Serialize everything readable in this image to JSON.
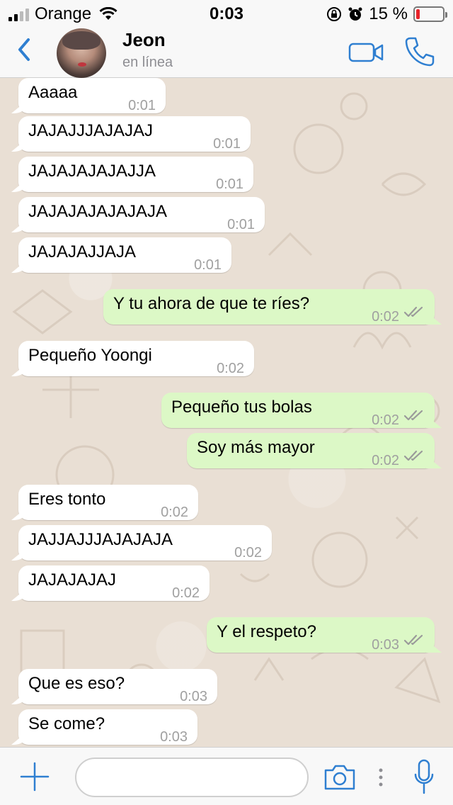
{
  "status_bar": {
    "carrier": "Orange",
    "time": "0:03",
    "battery_percent": "15 %",
    "battery_level": 0.15,
    "signal_bars": 2
  },
  "header": {
    "contact_name": "Jeon",
    "contact_status": "en línea",
    "icons": [
      "back-icon",
      "video-call-icon",
      "phone-icon"
    ]
  },
  "messages": [
    {
      "dir": "in",
      "text": "Aaaaa",
      "time": "0:01"
    },
    {
      "dir": "in",
      "text": "JAJAJJJAJAJAJ",
      "time": "0:01"
    },
    {
      "dir": "in",
      "text": "JAJAJAJAJAJJA",
      "time": "0:01"
    },
    {
      "dir": "in",
      "text": "JAJAJAJAJAJAJA",
      "time": "0:01"
    },
    {
      "dir": "in",
      "text": "JAJAJAJJAJA",
      "time": "0:01"
    },
    {
      "dir": "out",
      "text": "Y tu ahora de que te ríes?",
      "time": "0:02"
    },
    {
      "dir": "in",
      "text": "Pequeño Yoongi",
      "time": "0:02"
    },
    {
      "dir": "out",
      "text": "Pequeño tus bolas",
      "time": "0:02"
    },
    {
      "dir": "out",
      "text": "Soy más mayor",
      "time": "0:02"
    },
    {
      "dir": "in",
      "text": "Eres tonto",
      "time": "0:02"
    },
    {
      "dir": "in",
      "text": "JAJJAJJJAJAJAJA",
      "time": "0:02"
    },
    {
      "dir": "in",
      "text": "JAJAJAJAJ",
      "time": "0:02"
    },
    {
      "dir": "out",
      "text": "Y el respeto?",
      "time": "0:03"
    },
    {
      "dir": "in",
      "text": "Que es eso?",
      "time": "0:03"
    },
    {
      "dir": "in",
      "text": "Se come?",
      "time": "0:03"
    }
  ],
  "input_bar": {
    "placeholder": "",
    "icons": [
      "plus-icon",
      "camera-icon",
      "more-icon",
      "microphone-icon"
    ]
  },
  "colors": {
    "accent": "#2f7fd1",
    "incoming_bubble": "#ffffff",
    "outgoing_bubble": "#dcf8c6",
    "chat_background": "#e9dfd4",
    "battery_low": "#e8232a"
  }
}
